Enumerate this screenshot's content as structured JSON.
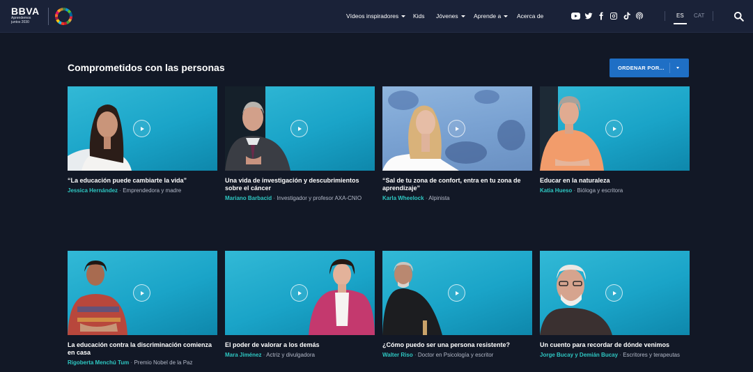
{
  "header": {
    "logo_main": "BBVA",
    "logo_sub_line1": "Aprendemos",
    "logo_sub_line2": "juntos 2030",
    "nav": [
      {
        "label": "Vídeos inspiradores",
        "has_caret": true
      },
      {
        "label": "Kids",
        "has_caret": false
      },
      {
        "label": "Jóvenes",
        "has_caret": true
      },
      {
        "label": "Aprende a",
        "has_caret": true
      },
      {
        "label": "Acerca de",
        "has_caret": false
      }
    ],
    "social_icons": [
      "youtube-icon",
      "twitter-icon",
      "facebook-icon",
      "instagram-icon",
      "tiktok-icon",
      "podcast-icon"
    ],
    "languages": [
      {
        "code": "ES",
        "active": true
      },
      {
        "code": "CAT",
        "active": false
      }
    ],
    "search_icon": "search-icon"
  },
  "section": {
    "title": "Comprometidos con las personas",
    "sort_label": "ORDENAR POR..."
  },
  "colors": {
    "background": "#121826",
    "header": "#1a2238",
    "accent_name": "#2ec7c2",
    "sort_button": "#1f6fc5"
  },
  "cards": [
    {
      "title": "“La educación puede cambiarte la vida”",
      "name": "Jessica Hernández",
      "role": "Emprendedora y madre"
    },
    {
      "title": "Una vida de investigación y descubrimientos sobre el cáncer",
      "name": "Mariano Barbacid",
      "role": "Investigador y profesor AXA-CNIO"
    },
    {
      "title": "“Sal de tu zona de confort, entra en tu zona de aprendizaje”",
      "name": "Karla Wheelock",
      "role": "Alpinista"
    },
    {
      "title": "Educar en la naturaleza",
      "name": "Katia Hueso",
      "role": "Bióloga y escritora"
    },
    {
      "title": "La educación contra la discriminación comienza en casa",
      "name": "Rigoberta Menchú Tum",
      "role": "Premio Nobel de la Paz"
    },
    {
      "title": "El poder de valorar a los demás",
      "name": "Mara Jiménez",
      "role": "Actriz y divulgadora"
    },
    {
      "title": "¿Cómo puedo ser una persona resistente?",
      "name": "Walter Riso",
      "role": "Doctor en Psicología y escritor"
    },
    {
      "title": "Un cuento para recordar de dónde venimos",
      "name": "Jorge Bucay y Demián Bucay",
      "role": "Escritores y terapeutas"
    }
  ]
}
